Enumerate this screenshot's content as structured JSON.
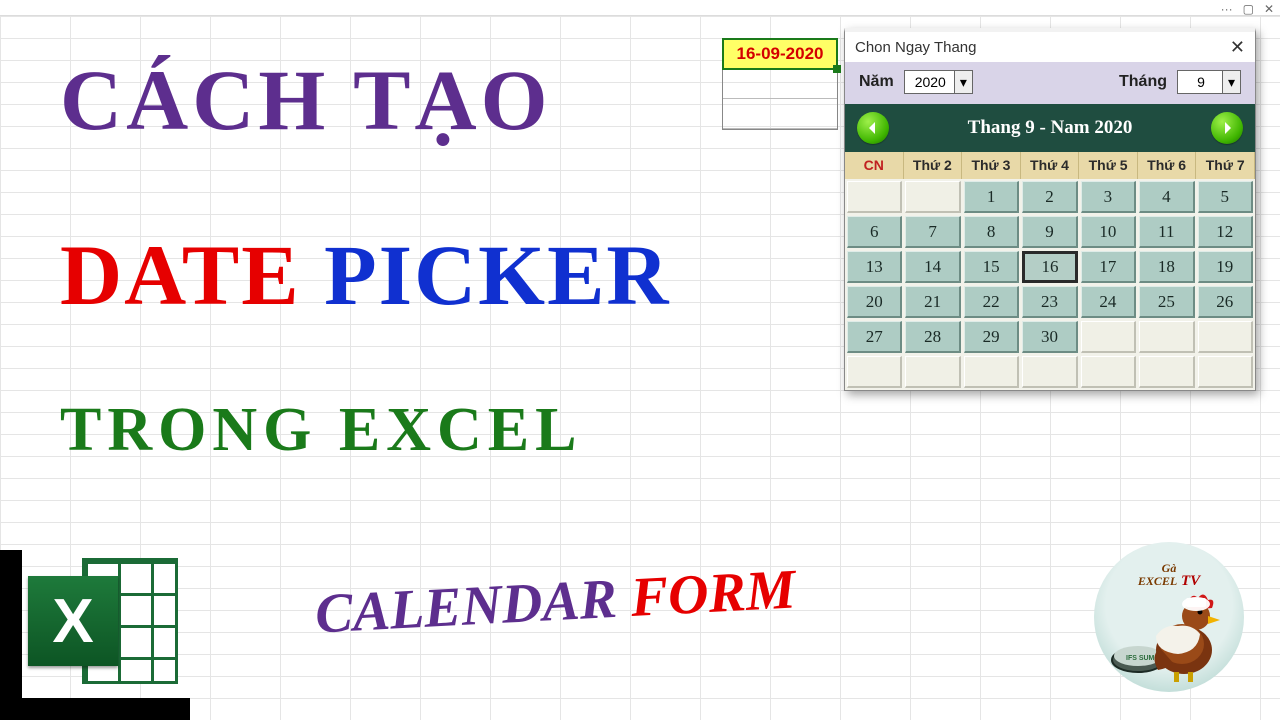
{
  "window_controls": {
    "dots": "···",
    "up": "▢",
    "close": "✕"
  },
  "headline": {
    "l1": "CÁCH TẠO",
    "l2a": "DATE ",
    "l2b": "PICKER",
    "l3": "TRONG EXCEL",
    "l4a": "CALENDAR ",
    "l4b": "FORM"
  },
  "selected_cell": "16-09-2020",
  "popup": {
    "title": "Chon Ngay Thang",
    "year_label": "Năm",
    "year_value": "2020",
    "month_label": "Tháng",
    "month_value": "9",
    "nav_caption": "Thang 9 - Nam 2020",
    "dow": [
      "CN",
      "Thứ 2",
      "Thứ 3",
      "Thứ 4",
      "Thứ 5",
      "Thứ 6",
      "Thứ 7"
    ],
    "leading_blanks": 2,
    "days_in_month": 30,
    "today": 16,
    "trailing_rows_pad_to": 42
  },
  "excel_icon_letter": "X",
  "channel": {
    "line1": "Gà",
    "line2": "EXCEL",
    "tv": " TV"
  }
}
